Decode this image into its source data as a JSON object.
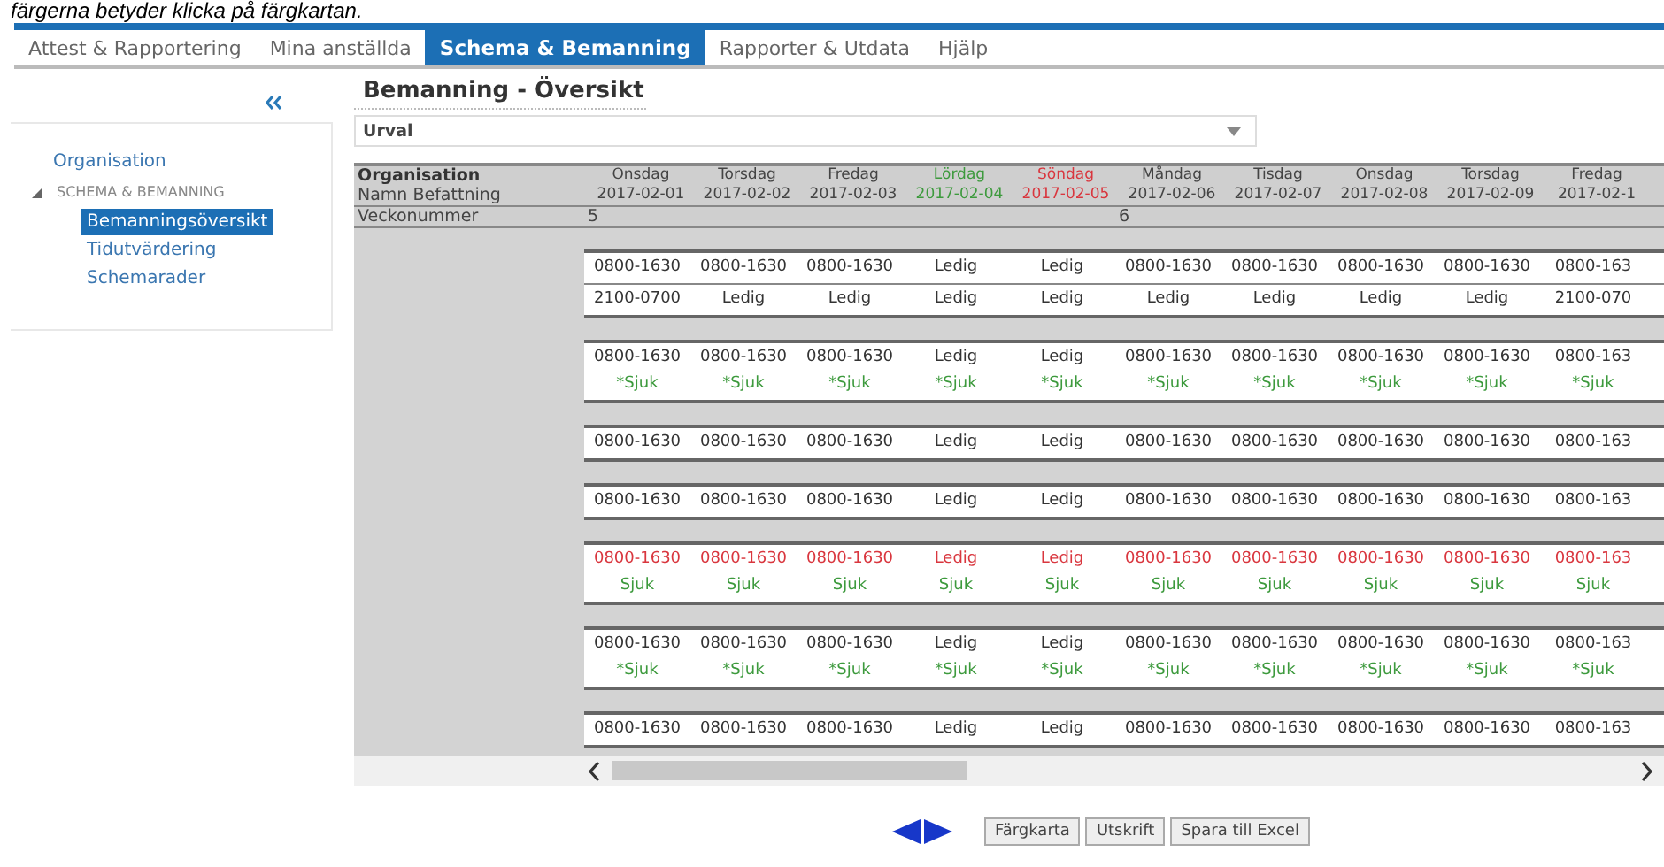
{
  "caption": "färgerna betyder klicka på färgkartan.",
  "tabs": [
    {
      "label": "Attest & Rapportering",
      "selected": false
    },
    {
      "label": "Mina anställda",
      "selected": false
    },
    {
      "label": "Schema & Bemanning",
      "selected": true
    },
    {
      "label": "Rapporter & Utdata",
      "selected": false
    },
    {
      "label": "Hjälp",
      "selected": false
    }
  ],
  "sidebar": {
    "items": [
      {
        "label": "Organisation"
      },
      {
        "label": "SCHEMA & BEMANNING",
        "expanded": true,
        "children": [
          {
            "label": "Bemanningsöversikt",
            "selected": true
          },
          {
            "label": "Tidutvärdering",
            "selected": false
          },
          {
            "label": "Schemarader",
            "selected": false
          }
        ]
      }
    ]
  },
  "page_title": "Bemanning - Översikt",
  "filter": {
    "value": "Urval"
  },
  "table": {
    "header_labels": [
      "Organisation",
      "Namn Befattning"
    ],
    "week_label": "Veckonummer",
    "days": [
      {
        "name": "Onsdag",
        "date": "2017-02-01",
        "week": "5",
        "color": "#444444"
      },
      {
        "name": "Torsdag",
        "date": "2017-02-02",
        "color": "#444444"
      },
      {
        "name": "Fredag",
        "date": "2017-02-03",
        "color": "#444444"
      },
      {
        "name": "Lördag",
        "date": "2017-02-04",
        "color": "#3d9a3d"
      },
      {
        "name": "Söndag",
        "date": "2017-02-05",
        "color": "#d9363e"
      },
      {
        "name": "Måndag",
        "date": "2017-02-06",
        "week": "6",
        "color": "#444444"
      },
      {
        "name": "Tisdag",
        "date": "2017-02-07",
        "color": "#444444"
      },
      {
        "name": "Onsdag",
        "date": "2017-02-08",
        "color": "#444444"
      },
      {
        "name": "Torsdag",
        "date": "2017-02-09",
        "color": "#444444"
      },
      {
        "name": "Fredag",
        "date": "2017-02-1",
        "color": "#444444"
      }
    ],
    "groups": [
      {
        "rows": [
          {
            "flagged": false,
            "cells": [
              {
                "shift": "0800-1630"
              },
              {
                "shift": "0800-1630"
              },
              {
                "shift": "0800-1630"
              },
              {
                "shift": "Ledig"
              },
              {
                "shift": "Ledig"
              },
              {
                "shift": "0800-1630"
              },
              {
                "shift": "0800-1630"
              },
              {
                "shift": "0800-1630"
              },
              {
                "shift": "0800-1630"
              },
              {
                "shift": "0800-163"
              }
            ]
          },
          {
            "flagged": false,
            "cells": [
              {
                "shift": "2100-0700"
              },
              {
                "shift": "Ledig"
              },
              {
                "shift": "Ledig"
              },
              {
                "shift": "Ledig"
              },
              {
                "shift": "Ledig"
              },
              {
                "shift": "Ledig"
              },
              {
                "shift": "Ledig"
              },
              {
                "shift": "Ledig"
              },
              {
                "shift": "Ledig"
              },
              {
                "shift": "2100-070"
              }
            ]
          }
        ]
      },
      {
        "rows": [
          {
            "flagged": false,
            "cells": [
              {
                "shift": "0800-1630",
                "note": "*Sjuk"
              },
              {
                "shift": "0800-1630",
                "note": "*Sjuk"
              },
              {
                "shift": "0800-1630",
                "note": "*Sjuk"
              },
              {
                "shift": "Ledig",
                "note": "*Sjuk"
              },
              {
                "shift": "Ledig",
                "note": "*Sjuk"
              },
              {
                "shift": "0800-1630",
                "note": "*Sjuk"
              },
              {
                "shift": "0800-1630",
                "note": "*Sjuk"
              },
              {
                "shift": "0800-1630",
                "note": "*Sjuk"
              },
              {
                "shift": "0800-1630",
                "note": "*Sjuk"
              },
              {
                "shift": "0800-163",
                "note": "*Sjuk"
              }
            ]
          }
        ]
      },
      {
        "rows": [
          {
            "flagged": false,
            "cells": [
              {
                "shift": "0800-1630"
              },
              {
                "shift": "0800-1630"
              },
              {
                "shift": "0800-1630"
              },
              {
                "shift": "Ledig"
              },
              {
                "shift": "Ledig"
              },
              {
                "shift": "0800-1630"
              },
              {
                "shift": "0800-1630"
              },
              {
                "shift": "0800-1630"
              },
              {
                "shift": "0800-1630"
              },
              {
                "shift": "0800-163"
              }
            ]
          }
        ]
      },
      {
        "rows": [
          {
            "flagged": false,
            "cells": [
              {
                "shift": "0800-1630"
              },
              {
                "shift": "0800-1630"
              },
              {
                "shift": "0800-1630"
              },
              {
                "shift": "Ledig"
              },
              {
                "shift": "Ledig"
              },
              {
                "shift": "0800-1630"
              },
              {
                "shift": "0800-1630"
              },
              {
                "shift": "0800-1630"
              },
              {
                "shift": "0800-1630"
              },
              {
                "shift": "0800-163"
              }
            ]
          }
        ]
      },
      {
        "rows": [
          {
            "flagged": true,
            "cells": [
              {
                "shift": "0800-1630",
                "note": "Sjuk"
              },
              {
                "shift": "0800-1630",
                "note": "Sjuk"
              },
              {
                "shift": "0800-1630",
                "note": "Sjuk"
              },
              {
                "shift": "Ledig",
                "note": "Sjuk"
              },
              {
                "shift": "Ledig",
                "note": "Sjuk"
              },
              {
                "shift": "0800-1630",
                "note": "Sjuk"
              },
              {
                "shift": "0800-1630",
                "note": "Sjuk"
              },
              {
                "shift": "0800-1630",
                "note": "Sjuk"
              },
              {
                "shift": "0800-1630",
                "note": "Sjuk"
              },
              {
                "shift": "0800-163",
                "note": "Sjuk"
              }
            ]
          }
        ]
      },
      {
        "rows": [
          {
            "flagged": false,
            "cells": [
              {
                "shift": "0800-1630",
                "note": "*Sjuk"
              },
              {
                "shift": "0800-1630",
                "note": "*Sjuk"
              },
              {
                "shift": "0800-1630",
                "note": "*Sjuk"
              },
              {
                "shift": "Ledig",
                "note": "*Sjuk"
              },
              {
                "shift": "Ledig",
                "note": "*Sjuk"
              },
              {
                "shift": "0800-1630",
                "note": "*Sjuk"
              },
              {
                "shift": "0800-1630",
                "note": "*Sjuk"
              },
              {
                "shift": "0800-1630",
                "note": "*Sjuk"
              },
              {
                "shift": "0800-1630",
                "note": "*Sjuk"
              },
              {
                "shift": "0800-163",
                "note": "*Sjuk"
              }
            ]
          }
        ]
      },
      {
        "rows": [
          {
            "flagged": false,
            "cells": [
              {
                "shift": "0800-1630"
              },
              {
                "shift": "0800-1630"
              },
              {
                "shift": "0800-1630"
              },
              {
                "shift": "Ledig"
              },
              {
                "shift": "Ledig"
              },
              {
                "shift": "0800-1630"
              },
              {
                "shift": "0800-1630"
              },
              {
                "shift": "0800-1630"
              },
              {
                "shift": "0800-1630"
              },
              {
                "shift": "0800-163"
              }
            ]
          }
        ]
      }
    ]
  },
  "buttons": [
    "Färgkarta",
    "Utskrift",
    "Spara till Excel"
  ]
}
